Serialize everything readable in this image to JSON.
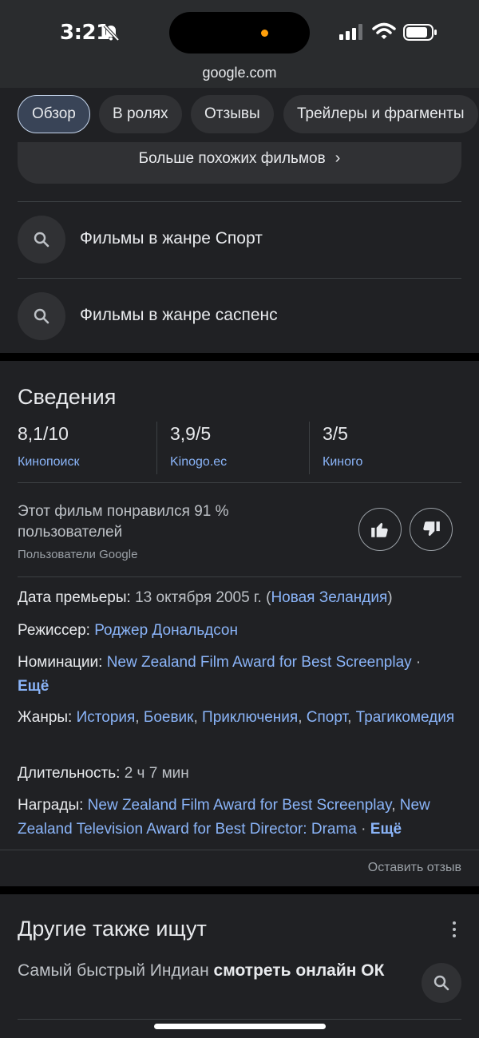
{
  "status_bar": {
    "time": "3:21",
    "icons": [
      "bell-slash-icon",
      "cellular-signal-icon",
      "wifi-icon",
      "battery-icon"
    ]
  },
  "url_bar": {
    "domain": "google.com"
  },
  "tabs": [
    {
      "label": "Обзор",
      "active": true
    },
    {
      "label": "В ролях",
      "active": false
    },
    {
      "label": "Отзывы",
      "active": false
    },
    {
      "label": "Трейлеры и фрагменты",
      "active": false
    }
  ],
  "more_films": {
    "label": "Больше похожих фильмов"
  },
  "related_searches": [
    {
      "label": "Фильмы в жанре Спорт",
      "icon": "search-icon"
    },
    {
      "label": "Фильмы в жанре саспенс",
      "icon": "search-icon"
    }
  ],
  "info": {
    "title": "Сведения",
    "ratings": [
      {
        "value": "8,1/10",
        "source": "Кинопоиск"
      },
      {
        "value": "3,9/5",
        "source": "Kinogo.ec"
      },
      {
        "value": "3/5",
        "source": "Киного"
      }
    ],
    "likes_text": "Этот фильм понравился 91 % пользователей",
    "likes_source": "Пользователи Google",
    "facts": {
      "release": {
        "key": "Дата премьеры:",
        "value": " 13 октября 2005 г. (",
        "link": "Новая Зеландия",
        "tail": ")"
      },
      "director": {
        "key": "Режиссер:",
        "link": "Роджер Дональдсон"
      },
      "nominations": {
        "key": "Номинации:",
        "link": "New Zealand Film Award for Best Screenplay",
        "sep": " · ",
        "more": "Ещё"
      },
      "genres": {
        "key": "Жанры:",
        "links": [
          "История",
          "Боевик",
          "Приключения",
          "Спорт",
          "Трагикомедия"
        ]
      },
      "duration": {
        "key": "Длительность:",
        "value": " 2 ч 7 мин"
      },
      "awards": {
        "key": "Награды:",
        "link1": "New Zealand Film Award for Best Screenplay",
        "link2": "New Zealand Television Award for Best Director: Drama",
        "sep": " · ",
        "more": "Ещё"
      }
    },
    "feedback": "Оставить отзыв"
  },
  "others": {
    "title": "Другие также ищут",
    "item_normal": "Самый быстрый Индиан ",
    "item_bold": "смотреть онлайн ОК"
  },
  "colors": {
    "background": "#202124",
    "link": "#8ab4f8",
    "active_tab": "#394457"
  }
}
